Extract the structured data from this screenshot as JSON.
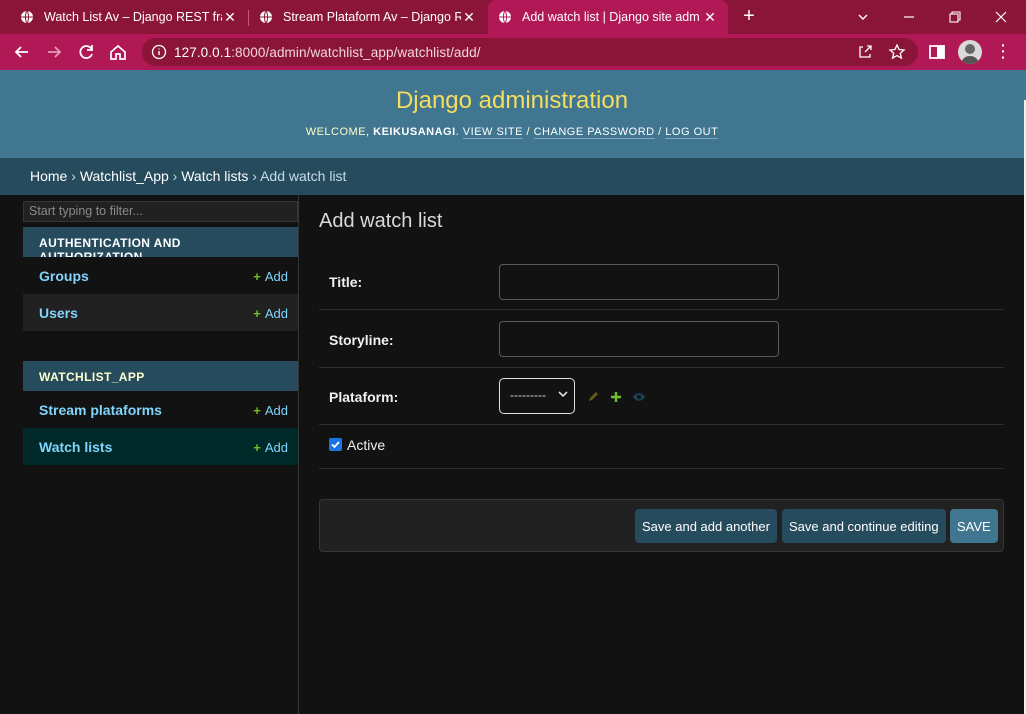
{
  "browser": {
    "tabs": [
      {
        "title": "Watch List Av – Django REST fram"
      },
      {
        "title": "Stream Plataform Av – Django RE"
      },
      {
        "title": "Add watch list | Django site admi"
      }
    ],
    "url_host": "127.0.0.1",
    "url_rest": ":8000/admin/watchlist_app/watchlist/add/",
    "close_glyph": "✕",
    "newtab_glyph": "+",
    "colors": {
      "frame": "#8a1538",
      "toolbar": "#b01955"
    }
  },
  "header": {
    "brand": "Django administration",
    "welcome": "Welcome,",
    "username": "keikusanagi",
    "view_site": "View site",
    "change_password": "Change password",
    "logout": "Log out",
    "sep": "/"
  },
  "breadcrumbs": {
    "home": "Home",
    "app": "Watchlist_App",
    "model": "Watch lists",
    "current": "Add watch list",
    "sep": "›"
  },
  "sidebar": {
    "filter_placeholder": "Start typing to filter...",
    "modules": [
      {
        "caption": "Authentication and Authorization",
        "items": [
          {
            "label": "Groups",
            "add": "Add"
          },
          {
            "label": "Users",
            "add": "Add"
          }
        ]
      },
      {
        "caption": "Watchlist_App",
        "items": [
          {
            "label": "Stream plataforms",
            "add": "Add"
          },
          {
            "label": "Watch lists",
            "add": "Add"
          }
        ]
      }
    ],
    "plus": "+"
  },
  "form": {
    "title": "Add watch list",
    "fields": {
      "title_label": "Title:",
      "storyline_label": "Storyline:",
      "platform_label": "Plataform:",
      "platform_value": "---------",
      "active_label": "Active"
    },
    "buttons": {
      "save_add_another": "Save and add another",
      "save_continue": "Save and continue editing",
      "save": "SAVE"
    }
  }
}
